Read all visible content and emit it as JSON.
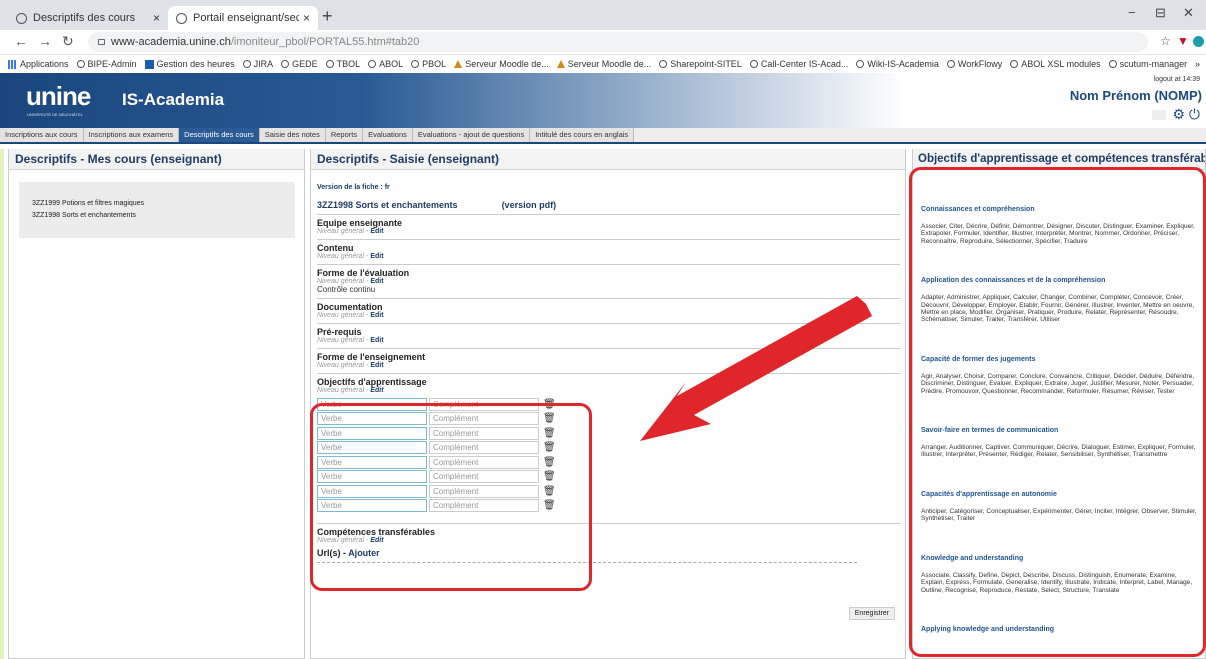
{
  "browser": {
    "tabs": [
      {
        "title": "Descriptifs des cours",
        "active": false
      },
      {
        "title": "Portail enseignant/secrétaire",
        "active": true
      }
    ],
    "new_tab": "+",
    "controls": [
      "−",
      "⊟",
      "✕"
    ],
    "url_host": "www-academia.unine.ch",
    "url_path": "/imoniteur_pbol/PORTAL55.htm#tab20",
    "bookmarks": [
      {
        "label": "Applications",
        "icon": "grid"
      },
      {
        "label": "BIPE-Admin",
        "icon": "dot"
      },
      {
        "label": "Gestion des heures",
        "icon": "sq"
      },
      {
        "label": "JIRA",
        "icon": "dot"
      },
      {
        "label": "GEDE",
        "icon": "dot"
      },
      {
        "label": "TBOL",
        "icon": "dot"
      },
      {
        "label": "ABOL",
        "icon": "dot"
      },
      {
        "label": "PBOL",
        "icon": "dot"
      },
      {
        "label": "Serveur Moodle de...",
        "icon": "tri"
      },
      {
        "label": "Serveur Moodle de...",
        "icon": "tri"
      },
      {
        "label": "Sharepoint-SITEL",
        "icon": "dot"
      },
      {
        "label": "Call-Center IS-Acad...",
        "icon": "dot"
      },
      {
        "label": "Wiki-IS-Academia",
        "icon": "dot"
      },
      {
        "label": "WorkFlowy",
        "icon": "dot"
      },
      {
        "label": "ABOL XSL modules",
        "icon": "dot"
      },
      {
        "label": "scutum-manager",
        "icon": "dot"
      }
    ],
    "more": "»"
  },
  "header": {
    "logo": "unine",
    "logo_sub": "UNIVERSITÉ DE NEUCHÂTEL",
    "title": "IS-Academia",
    "logout": "logout at 14:39",
    "user": "Nom Prénom (NOMP)"
  },
  "nav_tabs": [
    {
      "label": "Inscriptions aux cours",
      "active": false
    },
    {
      "label": "Inscriptions aux examens",
      "active": false
    },
    {
      "label": "Descriptifs des cours",
      "active": true
    },
    {
      "label": "Saisie des notes",
      "active": false
    },
    {
      "label": "Reports",
      "active": false
    },
    {
      "label": "Evaluations",
      "active": false
    },
    {
      "label": "Evaluations - ajout de questions",
      "active": false
    },
    {
      "label": "Intitulé des cours en anglais",
      "active": false
    }
  ],
  "left": {
    "title": "Descriptifs - Mes cours (enseignant)",
    "courses": [
      "3ZZ1999 Potions et filtres magiques",
      "3ZZ1998 Sorts et enchantements"
    ]
  },
  "middle": {
    "title": "Descriptifs - Saisie (enseignant)",
    "version": "Version de la fiche : fr",
    "course": "3ZZ1998 Sorts et enchantements",
    "pdf": "(version pdf)",
    "sections": [
      {
        "title": "Equipe enseignante",
        "level": "Niveau général",
        "edit": "Edit",
        "value": ""
      },
      {
        "title": "Contenu",
        "level": "Niveau général",
        "edit": "Edit",
        "value": ""
      },
      {
        "title": "Forme de l'évaluation",
        "level": "Niveau général",
        "edit": "Edit",
        "value": "Contrôle continu"
      },
      {
        "title": "Documentation",
        "level": "Niveau général",
        "edit": "Edit",
        "value": ""
      },
      {
        "title": "Pré-requis",
        "level": "Niveau général",
        "edit": "Edit",
        "value": ""
      },
      {
        "title": "Forme de l'enseignement",
        "level": "Niveau général",
        "edit": "Edit",
        "value": ""
      }
    ],
    "objectifs": {
      "title": "Objectifs d'apprentissage",
      "level": "Niveau général",
      "edit": "Edit",
      "verbe_placeholder": "Verbe",
      "complement_placeholder": "Complément",
      "row_count": 8
    },
    "competences": {
      "title": "Compétences transférables",
      "level": "Niveau général",
      "edit": "Edit"
    },
    "urls": {
      "label": "Url(s)",
      "add": "Ajouter"
    },
    "save": "Enregistrer"
  },
  "right": {
    "title": "Objectifs d'apprentissage et compétences transférables",
    "groups": [
      {
        "heading": "Connaissances et compréhension",
        "text": "Associer, Citer, Décrire, Définir, Démontrer, Désigner, Discuter, Distinguer, Examiner, Expliquer, Extrapoler, Formuler, Identifier, Illustrer, Interpréter, Montrer, Nommer, Ordonner, Préciser, Reconnaître, Reproduire, Sélectionner, Spécifier, Traduire"
      },
      {
        "heading": "Application des connaissances et de la compréhension",
        "text": "Adapter, Administrer, Appliquer, Calculer, Changer, Combiner, Compléter, Concevoir, Créer, Découvrir, Développer, Employer, Etablir, Fournir, Générer, Illustrer, Inventer, Mettre en oeuvre, Mettre en place, Modifier, Organiser, Pratiquer, Produire, Relater, Représenter, Résoudre, Schématiser, Simuler, Traiter, Transférer, Utiliser"
      },
      {
        "heading": "Capacité de former des jugements",
        "text": "Agir, Analyser, Choisir, Comparer, Conclure, Convaincre, Critiquer, Décider, Déduire, Défendre, Discriminer, Distinguer, Evaluer, Expliquer, Extraire, Juger, Justifier, Mesurer, Noter, Persuader, Prédire, Promouvoir, Questionner, Recommander, Reformuler, Résumer, Réviser, Tester"
      },
      {
        "heading": "Savoir-faire en termes de communication",
        "text": "Arranger, Auditionner, Captiver, Communiquer, Décrire, Dialoguer, Estimer, Expliquer, Formuler, Illustrer, Interpréter, Présenter, Rédiger, Relater, Sensibiliser, Synthétiser, Transmettre"
      },
      {
        "heading": "Capacités d'apprentissage en autonomie",
        "text": "Anticiper, Catégoriser, Conceptualiser, Expérimenter, Gérer, Inciter, Intégrer, Observer, Stimuler, Synthétiser, Traiter"
      },
      {
        "heading": "Knowledge and understanding",
        "text": "Associate, Classify, Define, Depict, Describe, Discuss, Distinguish, Enumerate, Examine, Explain, Express, Formulate, Generalise, Identify, Illustrate, Indicate, Interpret, Label, Manage, Outline, Recognise, Reproduce, Restate, Select, Structure, Translate"
      },
      {
        "heading": "Applying knowledge and understanding",
        "text": ""
      }
    ]
  },
  "colors": {
    "accent": "#1b467e",
    "highlight": "#e0262a",
    "arrow": "#e0262a"
  }
}
